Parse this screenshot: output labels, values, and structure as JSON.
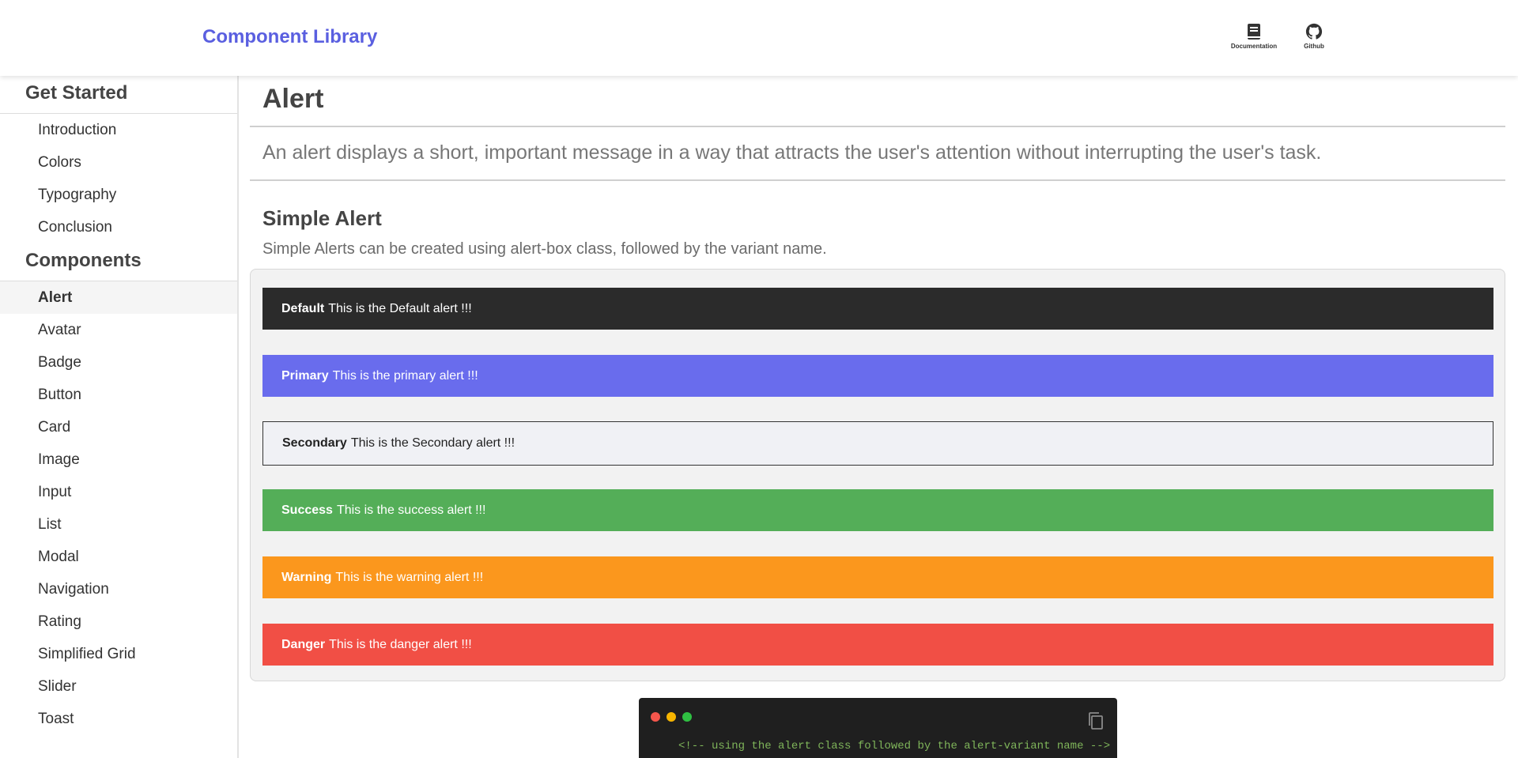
{
  "header": {
    "brand": "Component Library",
    "links": [
      {
        "label": "Documentation",
        "icon": "book-icon"
      },
      {
        "label": "Github",
        "icon": "github-icon"
      }
    ]
  },
  "sidebar": {
    "sections": [
      {
        "title": "Get Started",
        "items": [
          "Introduction",
          "Colors",
          "Typography",
          "Conclusion"
        ]
      },
      {
        "title": "Components",
        "items": [
          "Alert",
          "Avatar",
          "Badge",
          "Button",
          "Card",
          "Image",
          "Input",
          "List",
          "Modal",
          "Navigation",
          "Rating",
          "Simplified Grid",
          "Slider",
          "Toast"
        ]
      }
    ],
    "active_item": "Alert"
  },
  "main": {
    "title": "Alert",
    "description": "An alert displays a short, important message in a way that attracts the user's attention without interrupting the user's task.",
    "section_title": "Simple Alert",
    "section_description": "Simple Alerts can be created using alert-box class, followed by the variant name.",
    "alerts": [
      {
        "variant": "Default",
        "text": "This is the Default alert !!!",
        "bg": "#2b2b2b",
        "fg": "#ffffff",
        "border": "none"
      },
      {
        "variant": "Primary",
        "text": "This is the primary alert !!!",
        "bg": "#696ced",
        "fg": "#ffffff",
        "border": "none"
      },
      {
        "variant": "Secondary",
        "text": "This is the Secondary alert !!!",
        "bg": "#f0f1f5",
        "fg": "#222222",
        "border": "#333333"
      },
      {
        "variant": "Success",
        "text": "This is the success alert !!!",
        "bg": "#54ae58",
        "fg": "#ffffff",
        "border": "none"
      },
      {
        "variant": "Warning",
        "text": "This is the warning alert !!!",
        "bg": "#fb971d",
        "fg": "#ffffff",
        "border": "none"
      },
      {
        "variant": "Danger",
        "text": "This is the danger alert !!!",
        "bg": "#f14f45",
        "fg": "#ffffff",
        "border": "none"
      }
    ],
    "code": {
      "line1": "<!-- using the alert class followed by the alert-variant name -->",
      "line2": "",
      "dot_colors": [
        "#f4564c",
        "#f7b500",
        "#2fc042"
      ]
    }
  },
  "colors": {
    "brand": "#5a5fe0"
  }
}
